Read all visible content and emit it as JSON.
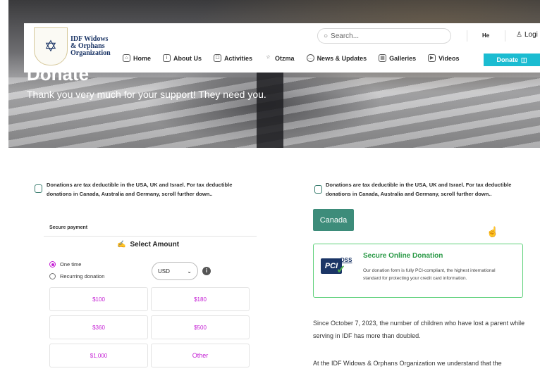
{
  "hero": {
    "title": "Donate",
    "subtitle": "Thank you very much for your support! They need you."
  },
  "header": {
    "logo_lines": [
      "IDF Widows",
      "& Orphans",
      "Organization"
    ],
    "search_placeholder": "Search...",
    "lang": "He",
    "login": "Logi",
    "donate": "Donate",
    "nav": [
      "Home",
      "About Us",
      "Activities",
      "Otzma",
      "News & Updates",
      "Galleries",
      "Videos"
    ]
  },
  "tax_note": "Donations are tax deductible in the USA, UK and Israel. For tax deductible donations in Canada, Australia and Germany, scroll further down..",
  "payment": {
    "secure_label": "Secure payment",
    "select_amount": "Select Amount",
    "frequency": [
      {
        "label": "One time",
        "selected": true
      },
      {
        "label": "Recurring donation",
        "selected": false
      }
    ],
    "currency": "USD",
    "amounts": [
      "$100",
      "$180",
      "$360",
      "$500",
      "$1,000",
      "Other"
    ]
  },
  "right": {
    "country_tab": "Canada",
    "secure_title": "Secure Online Donation",
    "secure_text": "Our donation form is fully PCI-compliant, the highest international standard for protecting your credit card information.",
    "pci_label": "PCI",
    "dss_label": "DSS",
    "para1": "Since October 7, 2023, the number of children who have lost a parent while serving in IDF has more than doubled.",
    "para2": "At the IDF Widows & Orphans Organization we understand that the"
  },
  "colors": {
    "accent_magenta": "#c41ed4",
    "cyan_button": "#1bbcd1",
    "teal": "#3d8c7a",
    "green": "#2b9a47"
  }
}
